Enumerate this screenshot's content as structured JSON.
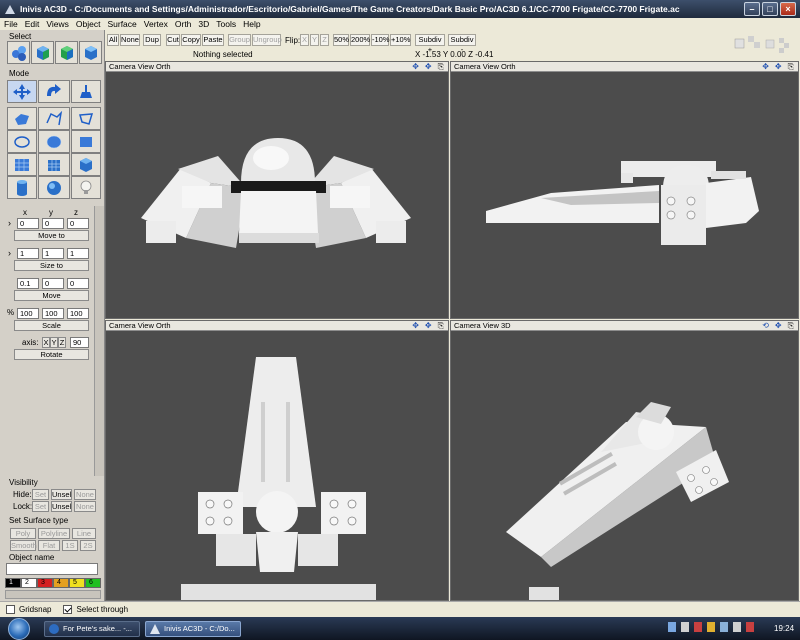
{
  "window": {
    "title": "Inivis AC3D - C:/Documents and Settings/Administrador/Escritorio/Gabriel/Games/The Game Creators/Dark Basic Pro/AC3D 6.1/CC-7700 Frigate/CC-7700 Frigate.ac"
  },
  "menu": [
    "File",
    "Edit",
    "Views",
    "Object",
    "Surface",
    "Vertex",
    "Orth",
    "3D",
    "Tools",
    "Help"
  ],
  "left": {
    "select_label": "Select",
    "mode_label": "Mode",
    "xyz": [
      "x",
      "y",
      "z"
    ],
    "move": {
      "values": [
        "0",
        "0",
        "0"
      ],
      "button": "Move to"
    },
    "size": {
      "values": [
        "1",
        "1",
        "1"
      ],
      "button": "Size to"
    },
    "movec": {
      "values": [
        "0.1",
        "0",
        "0"
      ],
      "button": "Move"
    },
    "scale": {
      "prefix": "%",
      "values": [
        "100",
        "100",
        "100"
      ],
      "button": "Scale"
    },
    "rotate": {
      "axis_label": "axis:",
      "axes": [
        "X",
        "Y",
        "Z"
      ],
      "angle": "90",
      "button": "Rotate"
    },
    "visibility": {
      "title": "Visibility",
      "hide": "Hide:",
      "lock": "Lock:",
      "set": "Set",
      "unsel": "Unsel",
      "none": "None"
    },
    "surface": {
      "title": "Set Surface type",
      "row1": [
        "Poly",
        "Polyline",
        "Line"
      ],
      "row2": [
        "Smooth",
        "Flat",
        "1S",
        "2S"
      ]
    },
    "object_name": {
      "label": "Object name",
      "value": ""
    },
    "palette": {
      "labels": [
        "1",
        "2",
        "3",
        "4",
        "5",
        "6"
      ],
      "colors": [
        "#000000",
        "#ffffff",
        "#d42020",
        "#e4a020",
        "#f0e020",
        "#20c020"
      ]
    }
  },
  "toolbar": {
    "buttons": [
      "All",
      "None",
      "Dup",
      "Cut",
      "Copy",
      "Paste",
      "Group",
      "Ungroup",
      "Flip:",
      "X",
      "Y",
      "Z",
      "50%",
      "200%",
      "-10%",
      "+10%",
      "Subdiv +",
      "Subdiv -"
    ],
    "status": "Nothing selected",
    "coords": "X -1.53 Y 0.00 Z -0.41"
  },
  "viewports": [
    {
      "label": "Camera  View  Orth"
    },
    {
      "label": "Camera  View  Orth"
    },
    {
      "label": "Camera  View  Orth"
    },
    {
      "label": "Camera  View  3D"
    }
  ],
  "statusbar": {
    "gridsnap": "Gridsnap",
    "select_through": "Select through"
  },
  "taskbar": {
    "items": [
      "For Pete's sake... -...",
      "Inivis AC3D - C:/Do..."
    ],
    "clock": "19:24"
  }
}
